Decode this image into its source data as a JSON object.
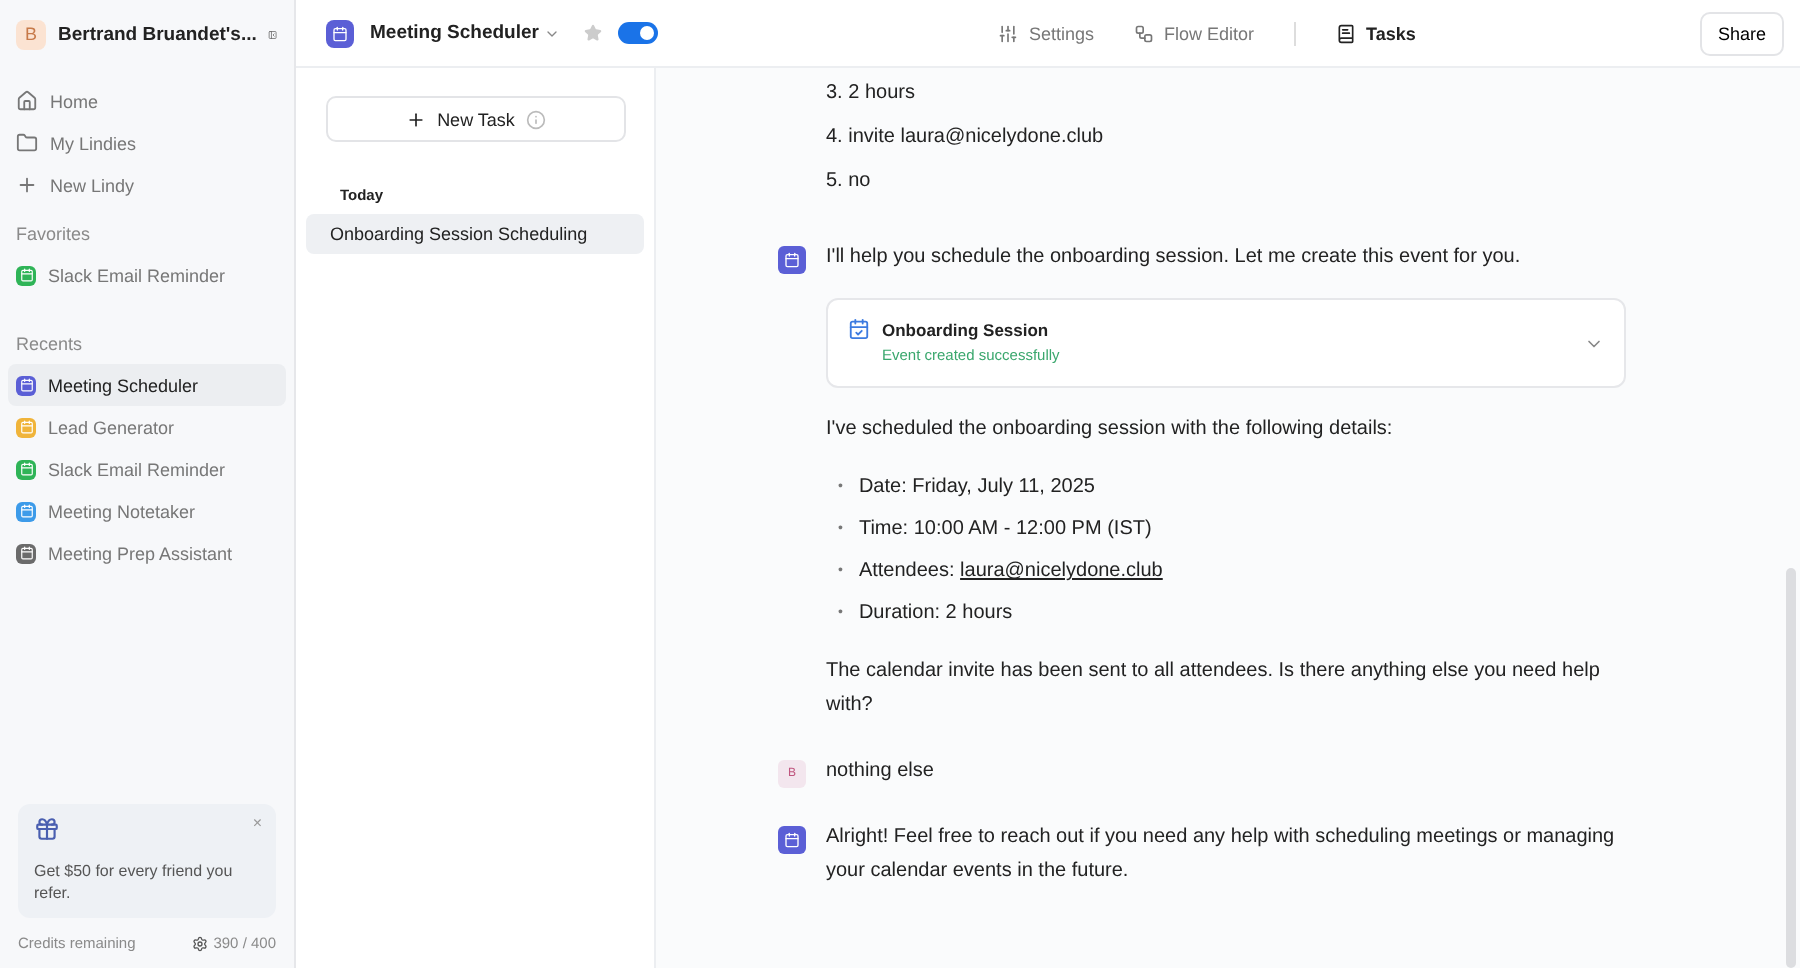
{
  "workspace": {
    "initial": "B",
    "name": "Bertrand Bruandet's..."
  },
  "nav": [
    {
      "kind": "home",
      "label": "Home"
    },
    {
      "kind": "folder",
      "label": "My Lindies"
    },
    {
      "kind": "plus",
      "label": "New Lindy"
    }
  ],
  "favorites": {
    "heading": "Favorites",
    "items": [
      {
        "label": "Slack Email Reminder",
        "color": "#2fb457",
        "selected": false
      }
    ]
  },
  "recents": {
    "heading": "Recents",
    "items": [
      {
        "label": "Meeting Scheduler",
        "color": "#5b5fd6",
        "selected": true
      },
      {
        "label": "Lead Generator",
        "color": "#f0b43a",
        "selected": false
      },
      {
        "label": "Slack Email Reminder",
        "color": "#2fb457",
        "selected": false
      },
      {
        "label": "Meeting Notetaker",
        "color": "#3d9be9",
        "selected": false
      },
      {
        "label": "Meeting Prep Assistant",
        "color": "#6b6b6b",
        "selected": false
      }
    ]
  },
  "promo": {
    "text": "Get $50 for every friend you refer.",
    "close": "×"
  },
  "credits": {
    "label": "Credits remaining",
    "value": "390 / 400"
  },
  "agent": {
    "name": "Meeting Scheduler",
    "starred": false,
    "on": true
  },
  "tabs": [
    {
      "kind": "settings",
      "label": "Settings",
      "selected": false
    },
    {
      "kind": "flow",
      "label": "Flow Editor",
      "selected": false
    },
    {
      "kind": "tasks",
      "label": "Tasks",
      "selected": true
    }
  ],
  "share": "Share",
  "new_task": "New Task",
  "task_groups": [
    {
      "heading": "Today",
      "tasks": [
        {
          "label": "Onboarding Session Scheduling",
          "selected": true
        }
      ]
    }
  ],
  "messages": [
    {
      "kind": "continued",
      "blocks": [
        {
          "kind": "lines",
          "lines": [
            "3. 2 hours",
            "4. invite laura@nicelydone.club",
            "5. no"
          ]
        }
      ]
    },
    {
      "kind": "agent",
      "blocks": [
        {
          "kind": "paragraph",
          "text": "I'll help you schedule the onboarding session. Let me create this event for you."
        },
        {
          "kind": "tool_card",
          "title": "Onboarding Session",
          "status": "Event created successfully"
        },
        {
          "kind": "paragraph",
          "text": "I've scheduled the onboarding session with the following details:"
        },
        {
          "kind": "bullets",
          "marker": "•",
          "items": [
            {
              "text": "Date: Friday, July 11, 2025"
            },
            {
              "text": "Time: 10:00 AM - 12:00 PM (IST)"
            },
            {
              "text": "Attendees:",
              "link": "laura@nicelydone.club"
            },
            {
              "text": "Duration: 2 hours"
            }
          ]
        },
        {
          "kind": "paragraph",
          "text": "The calendar invite has been sent to all attendees. Is there anything else you need help with?"
        }
      ]
    },
    {
      "kind": "user",
      "initial": "B",
      "blocks": [
        {
          "kind": "paragraph",
          "text": "nothing else"
        }
      ]
    },
    {
      "kind": "agent",
      "blocks": [
        {
          "kind": "paragraph",
          "text": "Alright! Feel free to reach out if you need any help with scheduling meetings or managing your calendar events in the future."
        }
      ]
    }
  ]
}
